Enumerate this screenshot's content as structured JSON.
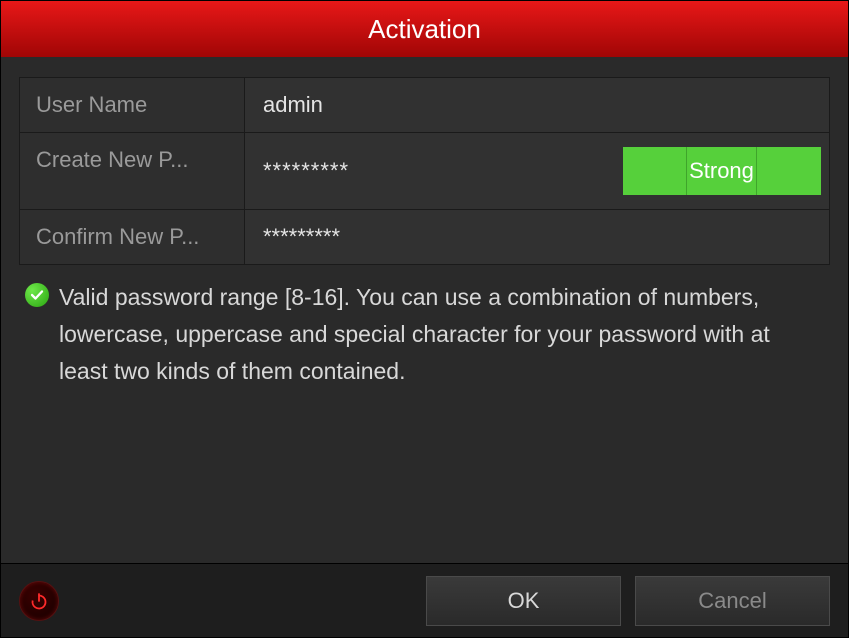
{
  "title": "Activation",
  "fields": {
    "username": {
      "label": "User Name",
      "value": "admin"
    },
    "password": {
      "label": "Create New P...",
      "value": "*********"
    },
    "confirm": {
      "label": "Confirm New P...",
      "value": "*********"
    }
  },
  "strength": {
    "label": "Strong"
  },
  "hint": "Valid password range [8-16]. You can use a combination of numbers, lowercase, uppercase and special character for your password with at least two kinds of them contained.",
  "buttons": {
    "ok": "OK",
    "cancel": "Cancel"
  }
}
